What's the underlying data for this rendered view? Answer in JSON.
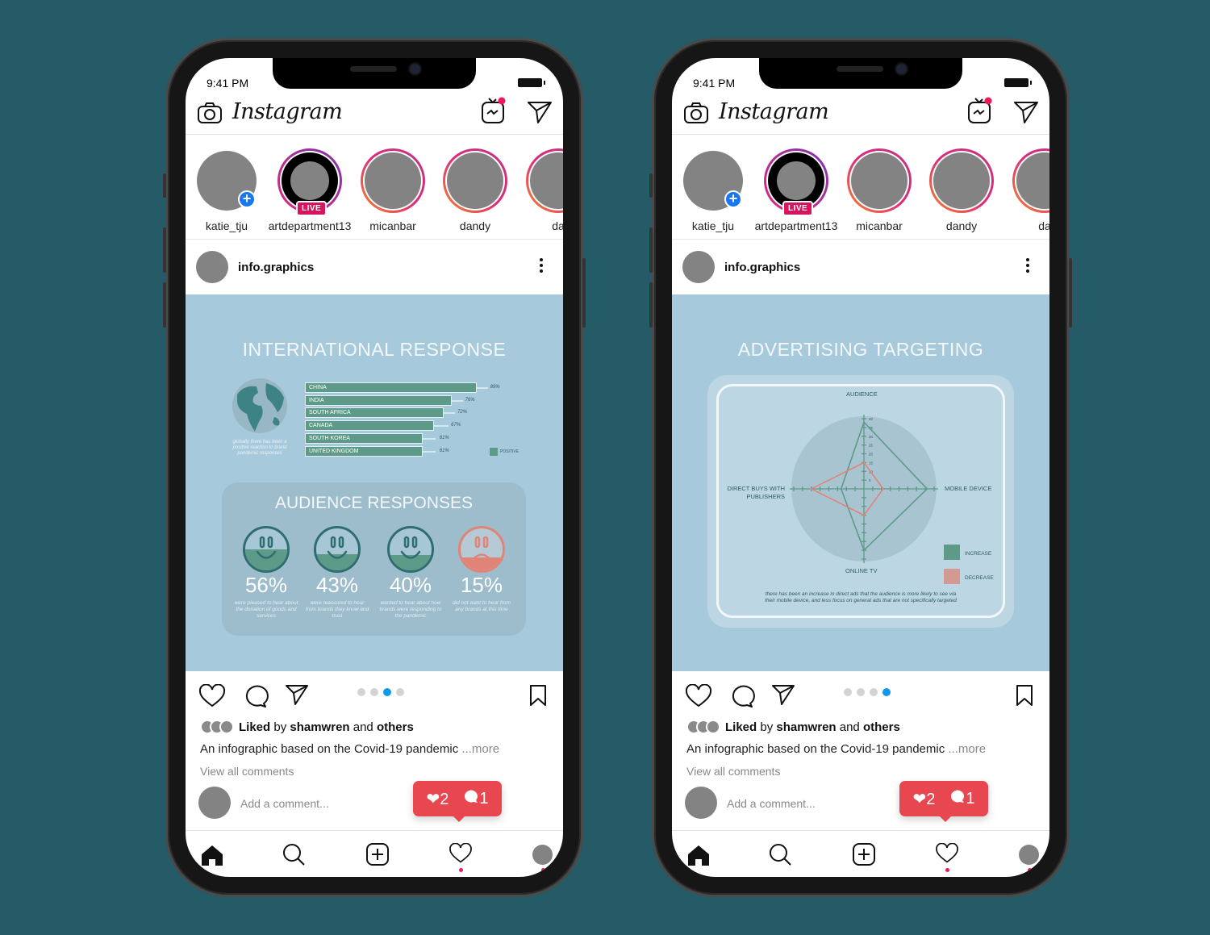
{
  "background_color": "#245b67",
  "accent_colors": {
    "teal": "#5d9b88",
    "coral": "#e18478",
    "image_bg": "#a7c9dc",
    "badge": "#e8474f",
    "active_dot": "#1199e8"
  },
  "phones": [
    {
      "status_time": "9:41 PM",
      "app_title": "Instagram",
      "icons": {
        "camera": "camera-icon",
        "igtv": "igtv-icon",
        "direct": "paper-plane-icon"
      },
      "stories": [
        {
          "name": "katie_tju",
          "type": "own"
        },
        {
          "name": "artdepartment13",
          "type": "live",
          "badge": "LIVE"
        },
        {
          "name": "micanbar",
          "type": "story"
        },
        {
          "name": "dandy",
          "type": "story"
        },
        {
          "name": "da",
          "type": "story"
        }
      ],
      "post": {
        "username": "info.graphics",
        "carousel_total": 4,
        "carousel_active": 3,
        "liked_prefix": "Liked",
        "liked_by": "by",
        "liked_user": "shamwren",
        "liked_and": "and",
        "liked_others": "others",
        "caption": "An infographic based on the Covid-19 pandemic",
        "more": "...more",
        "view_comments": "View all comments",
        "comment_placeholder": "Add a comment...",
        "notif_likes": "2",
        "notif_comments": "1"
      },
      "infographic": {
        "title": "INTERNATIONAL RESPONSE",
        "globe_caption": "globally there has been a positive reaction to brand pandemic responses",
        "legend": "POSITIVE",
        "audience_title": "AUDIENCE RESPONSES",
        "responses": [
          {
            "pct": "56%",
            "sentiment": "positive",
            "desc": "were pleased to hear about the donation of goods and services"
          },
          {
            "pct": "43%",
            "sentiment": "positive",
            "desc": "were reassured to hear from brands they know and trust"
          },
          {
            "pct": "40%",
            "sentiment": "positive",
            "desc": "wanted to hear about how brands were responding to the pandemic"
          },
          {
            "pct": "15%",
            "sentiment": "negative",
            "desc": "did not want to hear from any brands at this time"
          }
        ]
      }
    },
    {
      "status_time": "9:41 PM",
      "app_title": "Instagram",
      "icons": {
        "camera": "camera-icon",
        "igtv": "igtv-icon",
        "direct": "paper-plane-icon"
      },
      "stories": [
        {
          "name": "katie_tju",
          "type": "own"
        },
        {
          "name": "artdepartment13",
          "type": "live",
          "badge": "LIVE"
        },
        {
          "name": "micanbar",
          "type": "story"
        },
        {
          "name": "dandy",
          "type": "story"
        },
        {
          "name": "da",
          "type": "story"
        }
      ],
      "post": {
        "username": "info.graphics",
        "carousel_total": 4,
        "carousel_active": 4,
        "liked_prefix": "Liked",
        "liked_by": "by",
        "liked_user": "shamwren",
        "liked_and": "and",
        "liked_others": "others",
        "caption": "An infographic based on the Covid-19 pandemic",
        "more": "...more",
        "view_comments": "View all comments",
        "comment_placeholder": "Add a comment...",
        "notif_likes": "2",
        "notif_comments": "1"
      },
      "infographic": {
        "title": "ADVERTISING TARGETING",
        "caption_line1": "there has been an increase in direct ads that the audience is more likely to see via",
        "caption_line2": "their mobile device, and less focus on general ads that are not specifically targeted",
        "legend_increase": "INCREASE",
        "legend_decrease": "DECREASE"
      }
    }
  ],
  "chart_data": [
    {
      "type": "bar",
      "orientation": "horizontal",
      "title": "INTERNATIONAL RESPONSE",
      "categories": [
        "CHINA",
        "INDIA",
        "SOUTH AFRICA",
        "CANADA",
        "SOUTH KOREA",
        "UNITED KINGDOM"
      ],
      "values": [
        89,
        76,
        72,
        67,
        61,
        61
      ],
      "labels": [
        "89%",
        "76%",
        "72%",
        "67%",
        "61%",
        "61%"
      ],
      "series": [
        {
          "name": "POSITIVE",
          "values": [
            89,
            76,
            72,
            67,
            61,
            61
          ]
        }
      ],
      "xlim": [
        0,
        100
      ],
      "legend": "bottom-right"
    },
    {
      "type": "radar",
      "title": "ADVERTISING TARGETING",
      "axes": [
        "AUDIENCE",
        "MOBILE DEVICE",
        "ONLINE TV",
        "DIRECT BUYS WITH PUBLISHERS"
      ],
      "tick_labels": [
        "5",
        "10",
        "15",
        "20",
        "25",
        "30",
        "35",
        "40"
      ],
      "rlim": [
        0,
        40
      ],
      "series": [
        {
          "name": "INCREASE",
          "color": "#5d9b88",
          "values": [
            38,
            36,
            35,
            13
          ]
        },
        {
          "name": "DECREASE",
          "color": "#e18478",
          "values": [
            15,
            11,
            15,
            30
          ]
        }
      ],
      "legend": "bottom-right"
    }
  ]
}
